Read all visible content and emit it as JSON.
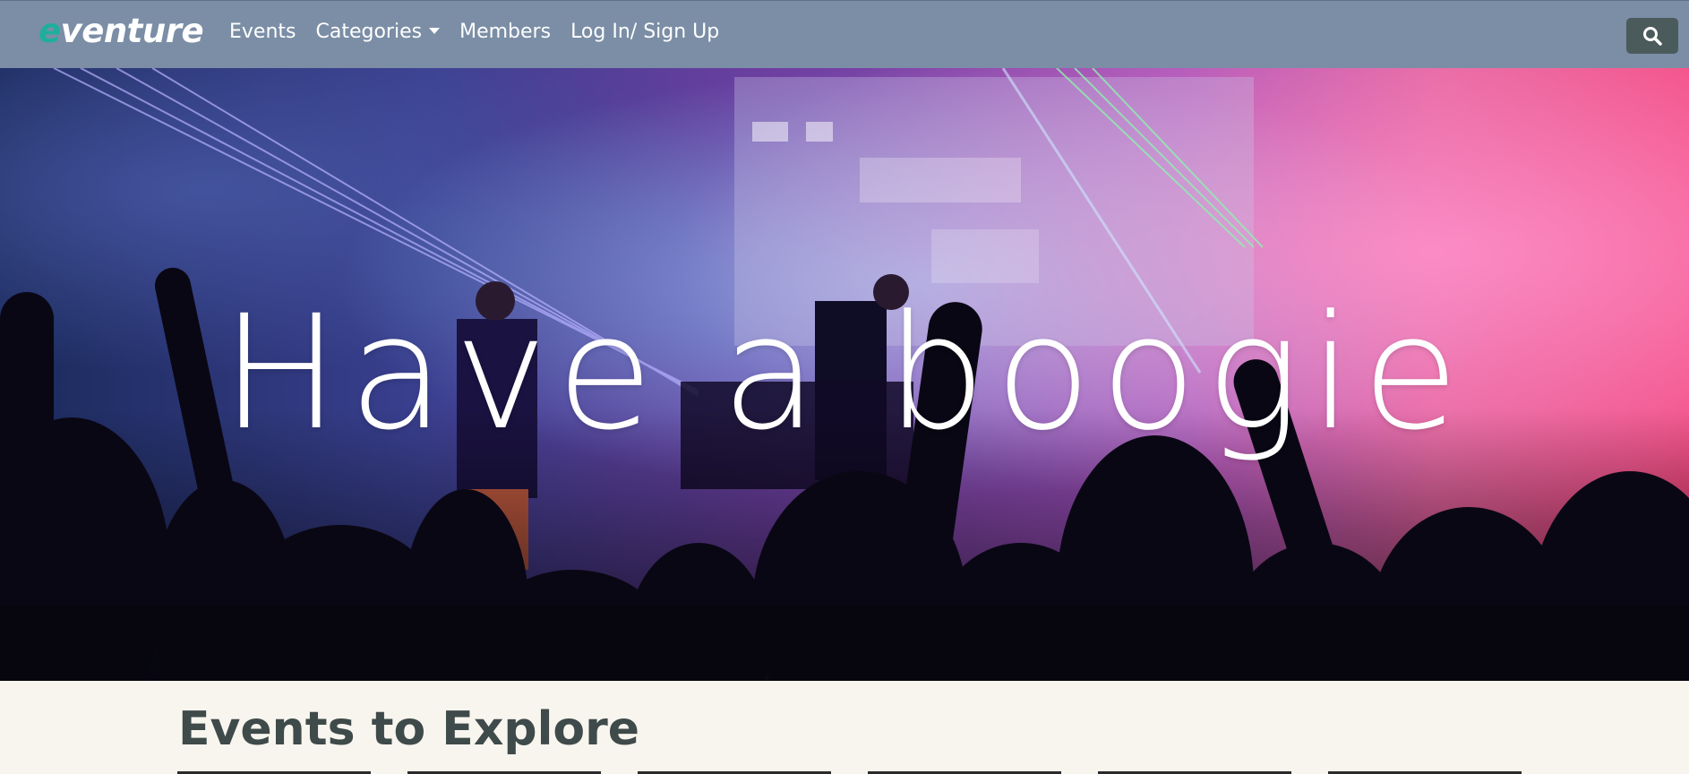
{
  "nav": {
    "brand_e": "e",
    "brand_rest": "venture",
    "links": [
      {
        "label": "Events"
      },
      {
        "label": "Categories",
        "has_dropdown": true
      },
      {
        "label": "Members"
      },
      {
        "label": "Log In/ Sign Up"
      }
    ],
    "search_icon": "search-icon"
  },
  "hero": {
    "title": "Have a boogie",
    "image": "concert-crowd-stage-lights"
  },
  "explore": {
    "title": "Events to Explore",
    "card_count": 6
  },
  "colors": {
    "navbar": "#7b8ea6",
    "brand_accent": "#1fae9b",
    "search_button": "#4b5a5b",
    "page_bg": "#f7f5ee",
    "heading_text": "#3f4a4a"
  }
}
